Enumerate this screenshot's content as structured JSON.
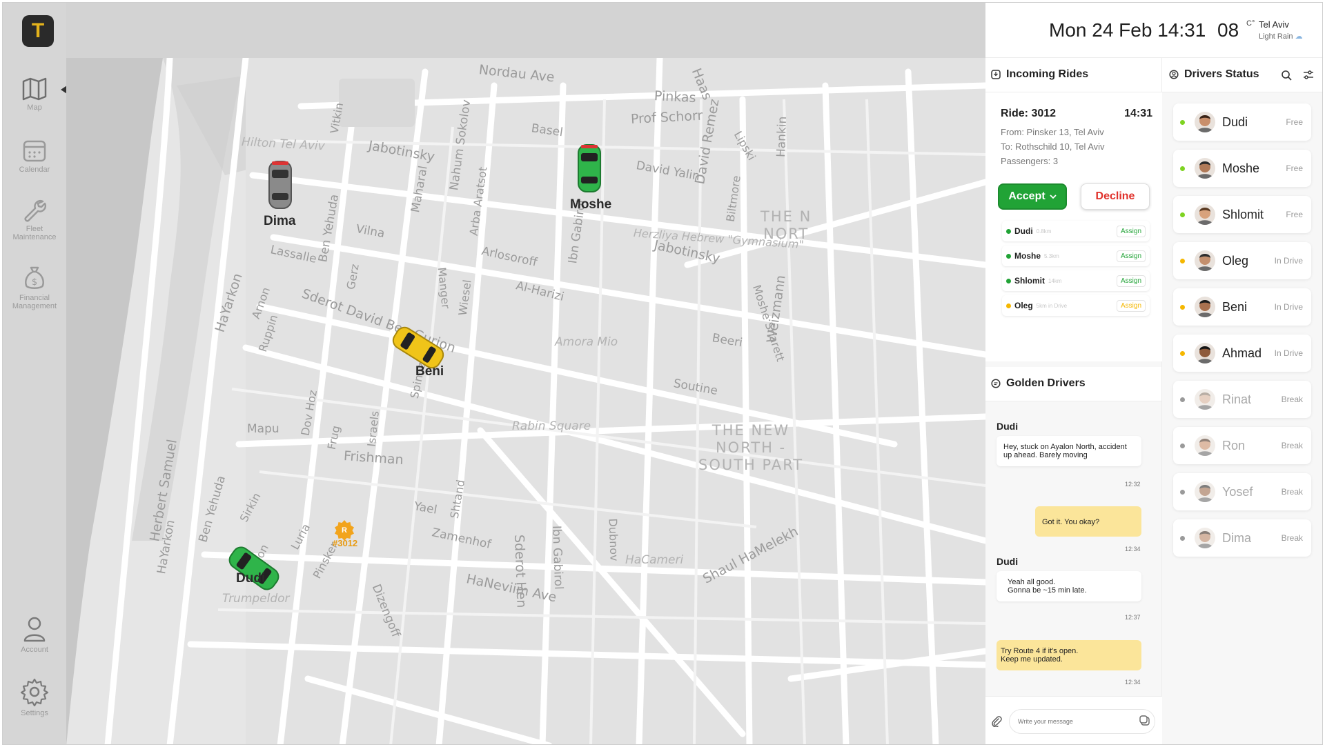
{
  "app": {
    "logo_letter": "T"
  },
  "sidebar": {
    "items": [
      {
        "label": "Map",
        "icon": "map-icon"
      },
      {
        "label": "Calendar",
        "icon": "calendar-icon"
      },
      {
        "label": "Fleet Maintenance",
        "icon": "wrench-icon"
      },
      {
        "label": "Financial Management",
        "icon": "money-bag-icon"
      },
      {
        "label": "Account",
        "icon": "user-icon"
      },
      {
        "label": "Settings",
        "icon": "gear-icon"
      }
    ]
  },
  "map": {
    "streets": [
      "Nordau Ave",
      "Pinkas",
      "Prof Schorr",
      "Haas",
      "Hilton Tel Aviv",
      "Vitkin",
      "Jabotinsky",
      "Basel",
      "Nahum Sokolov",
      "David Yalin",
      "David Remez",
      "Lipski",
      "Hankin",
      "Maharal",
      "Arba Aratsot",
      "Vilna",
      "Jabotinsky",
      "Biltmore",
      "Moshe Sharett",
      "Ben Yehuda",
      "Lassalle",
      "Arlosoroff",
      "Ibn Gabirol",
      "Herzliya Hebrew \"Gymnasium\"",
      "Gerz",
      "Manger",
      "Wiesel",
      "Al-Harizi",
      "Sderot David Ben Gurion",
      "HaYarkon",
      "Arnon",
      "Ruppin",
      "Amora Mio",
      "Beeri",
      "Weizmann",
      "Spinoza",
      "Soutine",
      "Mapu",
      "Dov Hoz",
      "Frug",
      "Israels",
      "Rabin Square",
      "Frishman",
      "Herbert Samuel",
      "HaYarkon",
      "Ben Yehuda",
      "Sirkin",
      "Luria",
      "Yael",
      "Shtand",
      "Zamenhof",
      "Sderot Hen",
      "Ibn Gabirol",
      "Dubnov",
      "HaCameri",
      "Shaul HaMelekh",
      "Pinsker",
      "Dizengoff",
      "HaNeviim Ave",
      "Trumpeldor",
      "Zion"
    ],
    "areas": [
      "THE N\nNORT",
      "THE NEW\nNORTH -\nSOUTH PART"
    ],
    "cars": [
      {
        "name": "Dima",
        "color": "#8a8a8a"
      },
      {
        "name": "Moshe",
        "color": "#2fb44a"
      },
      {
        "name": "Beni",
        "color": "#f0c419"
      },
      {
        "name": "Dudi",
        "color": "#2fb44a"
      }
    ],
    "pin_label": "#3012",
    "pin_letter": "R"
  },
  "header": {
    "datetime": "Mon 24 Feb 14:31",
    "temp": "08",
    "temp_unit": "C°",
    "city": "Tel Aviv",
    "weather": "Light Rain"
  },
  "incoming_rides": {
    "title": "Incoming Rides",
    "ride_id": "Ride: 3012",
    "time": "14:31",
    "from": "From: Pinsker 13, Tel Aviv",
    "to": "To: Rothschild 10, Tel Aviv",
    "passengers": "Passengers: 3",
    "accept_label": "Accept",
    "decline_label": "Decline",
    "assign_list": [
      {
        "name": "Dudi",
        "sub": "0.8km",
        "action": "Assign",
        "status": "free"
      },
      {
        "name": "Moshe",
        "sub": "5.3km",
        "action": "Assign",
        "status": "free"
      },
      {
        "name": "Shlomit",
        "sub": "14km",
        "action": "Assign",
        "status": "free"
      },
      {
        "name": "Oleg",
        "sub": "5km in Drive",
        "action": "Assign",
        "status": "drive"
      }
    ]
  },
  "chat": {
    "title": "Golden Drivers",
    "messages": [
      {
        "from": "Dudi",
        "text": "Hey, stuck on Ayalon North, accident up ahead. Barely moving",
        "time": "12:32",
        "dir": "in"
      },
      {
        "from": "",
        "text": "Got it. You okay?",
        "time": "12:34",
        "dir": "out"
      },
      {
        "from": "Dudi",
        "text": "Yeah all good.\nGonna be ~15 min late.",
        "time": "12:37",
        "dir": "in"
      },
      {
        "from": "",
        "text": "Try Route 4 if it's open.\nKeep me updated.",
        "time": "12:34",
        "dir": "out"
      }
    ],
    "input_placeholder": "Write your message"
  },
  "drivers": {
    "title": "Drivers Status",
    "list": [
      {
        "name": "Dudi",
        "status": "Free",
        "state": "free"
      },
      {
        "name": "Moshe",
        "status": "Free",
        "state": "free"
      },
      {
        "name": "Shlomit",
        "status": "Free",
        "state": "free"
      },
      {
        "name": "Oleg",
        "status": "In Drive",
        "state": "drive"
      },
      {
        "name": "Beni",
        "status": "In Drive",
        "state": "drive"
      },
      {
        "name": "Ahmad",
        "status": "In Drive",
        "state": "drive"
      },
      {
        "name": "Rinat",
        "status": "Break",
        "state": "break"
      },
      {
        "name": "Ron",
        "status": "Break",
        "state": "break"
      },
      {
        "name": "Yosef",
        "status": "Break",
        "state": "break"
      },
      {
        "name": "Dima",
        "status": "Break",
        "state": "break"
      }
    ]
  },
  "colors": {
    "free": "#7ed321",
    "drive": "#f5b700",
    "break": "#9a9a9a",
    "accept": "#21a336",
    "decline": "#e0312b",
    "bubble_out": "#fbe59a"
  }
}
